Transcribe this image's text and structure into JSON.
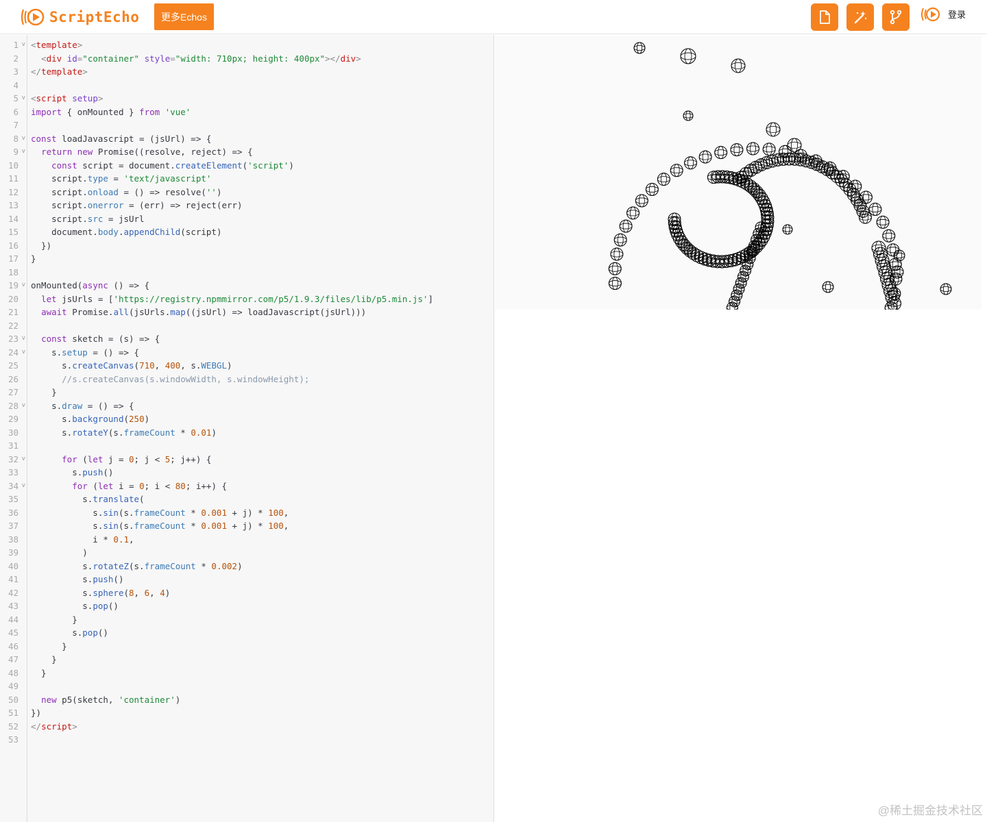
{
  "header": {
    "brand": "ScriptEcho",
    "more_label": "更多Echos",
    "buttons": [
      {
        "name": "new-file-button",
        "icon": "file-icon"
      },
      {
        "name": "magic-wand-button",
        "icon": "magic-wand-icon"
      },
      {
        "name": "fork-button",
        "icon": "git-fork-icon"
      }
    ],
    "login_label": "登录"
  },
  "colors": {
    "accent": "#f5821f"
  },
  "editor": {
    "lines": [
      [
        [
          "tk-punct",
          "<"
        ],
        [
          "tk-tag",
          "template"
        ],
        [
          "tk-punct",
          ">"
        ]
      ],
      [
        [
          "tk-plain",
          "  "
        ],
        [
          "tk-punct",
          "<"
        ],
        [
          "tk-tag",
          "div"
        ],
        [
          "tk-plain",
          " "
        ],
        [
          "tk-attr",
          "id"
        ],
        [
          "tk-punct",
          "="
        ],
        [
          "tk-str",
          "\"container\""
        ],
        [
          "tk-plain",
          " "
        ],
        [
          "tk-attr",
          "style"
        ],
        [
          "tk-punct",
          "="
        ],
        [
          "tk-str",
          "\"width: 710px; height: 400px\""
        ],
        [
          "tk-punct",
          "></"
        ],
        [
          "tk-tag",
          "div"
        ],
        [
          "tk-punct",
          ">"
        ]
      ],
      [
        [
          "tk-punct",
          "</"
        ],
        [
          "tk-tag",
          "template"
        ],
        [
          "tk-punct",
          ">"
        ]
      ],
      [],
      [
        [
          "tk-punct",
          "<"
        ],
        [
          "tk-tag",
          "script"
        ],
        [
          "tk-plain",
          " "
        ],
        [
          "tk-attr",
          "setup"
        ],
        [
          "tk-punct",
          ">"
        ]
      ],
      [
        [
          "tk-kw",
          "import"
        ],
        [
          "tk-plain",
          " { onMounted } "
        ],
        [
          "tk-kw",
          "from"
        ],
        [
          "tk-plain",
          " "
        ],
        [
          "tk-str",
          "'vue'"
        ]
      ],
      [],
      [
        [
          "tk-kw",
          "const"
        ],
        [
          "tk-plain",
          " loadJavascript = (jsUrl) => {"
        ]
      ],
      [
        [
          "tk-plain",
          "  "
        ],
        [
          "tk-kw",
          "return"
        ],
        [
          "tk-plain",
          " "
        ],
        [
          "tk-kw",
          "new"
        ],
        [
          "tk-plain",
          " Promise((resolve, reject) => {"
        ]
      ],
      [
        [
          "tk-plain",
          "    "
        ],
        [
          "tk-kw",
          "const"
        ],
        [
          "tk-plain",
          " script = document."
        ],
        [
          "tk-fn",
          "createElement"
        ],
        [
          "tk-plain",
          "("
        ],
        [
          "tk-str",
          "'script'"
        ],
        [
          "tk-plain",
          ")"
        ]
      ],
      [
        [
          "tk-plain",
          "    script."
        ],
        [
          "tk-prop",
          "type"
        ],
        [
          "tk-plain",
          " = "
        ],
        [
          "tk-str",
          "'text/javascript'"
        ]
      ],
      [
        [
          "tk-plain",
          "    script."
        ],
        [
          "tk-prop",
          "onload"
        ],
        [
          "tk-plain",
          " = () => resolve("
        ],
        [
          "tk-str",
          "''"
        ],
        [
          "tk-plain",
          ")"
        ]
      ],
      [
        [
          "tk-plain",
          "    script."
        ],
        [
          "tk-prop",
          "onerror"
        ],
        [
          "tk-plain",
          " = (err) => reject(err)"
        ]
      ],
      [
        [
          "tk-plain",
          "    script."
        ],
        [
          "tk-prop",
          "src"
        ],
        [
          "tk-plain",
          " = jsUrl"
        ]
      ],
      [
        [
          "tk-plain",
          "    document."
        ],
        [
          "tk-prop",
          "body"
        ],
        [
          "tk-plain",
          "."
        ],
        [
          "tk-fn",
          "appendChild"
        ],
        [
          "tk-plain",
          "(script)"
        ]
      ],
      [
        [
          "tk-plain",
          "  })"
        ]
      ],
      [
        [
          "tk-plain",
          "}"
        ]
      ],
      [],
      [
        [
          "tk-plain",
          "onMounted("
        ],
        [
          "tk-kw",
          "async"
        ],
        [
          "tk-plain",
          " () => {"
        ]
      ],
      [
        [
          "tk-plain",
          "  "
        ],
        [
          "tk-kw",
          "let"
        ],
        [
          "tk-plain",
          " jsUrls = ["
        ],
        [
          "tk-str",
          "'https://registry.npmmirror.com/p5/1.9.3/files/lib/p5.min.js'"
        ],
        [
          "tk-plain",
          "]"
        ]
      ],
      [
        [
          "tk-plain",
          "  "
        ],
        [
          "tk-kw",
          "await"
        ],
        [
          "tk-plain",
          " Promise."
        ],
        [
          "tk-fn",
          "all"
        ],
        [
          "tk-plain",
          "(jsUrls."
        ],
        [
          "tk-fn",
          "map"
        ],
        [
          "tk-plain",
          "((jsUrl) => loadJavascript(jsUrl)))"
        ]
      ],
      [],
      [
        [
          "tk-plain",
          "  "
        ],
        [
          "tk-kw",
          "const"
        ],
        [
          "tk-plain",
          " sketch = (s) => {"
        ]
      ],
      [
        [
          "tk-plain",
          "    s."
        ],
        [
          "tk-prop",
          "setup"
        ],
        [
          "tk-plain",
          " = () => {"
        ]
      ],
      [
        [
          "tk-plain",
          "      s."
        ],
        [
          "tk-fn",
          "createCanvas"
        ],
        [
          "tk-plain",
          "("
        ],
        [
          "tk-num",
          "710"
        ],
        [
          "tk-plain",
          ", "
        ],
        [
          "tk-num",
          "400"
        ],
        [
          "tk-plain",
          ", s."
        ],
        [
          "tk-prop",
          "WEBGL"
        ],
        [
          "tk-plain",
          ")"
        ]
      ],
      [
        [
          "tk-plain",
          "      "
        ],
        [
          "tk-cmt",
          "//s.createCanvas(s.windowWidth, s.windowHeight);"
        ]
      ],
      [
        [
          "tk-plain",
          "    }"
        ]
      ],
      [
        [
          "tk-plain",
          "    s."
        ],
        [
          "tk-prop",
          "draw"
        ],
        [
          "tk-plain",
          " = () => {"
        ]
      ],
      [
        [
          "tk-plain",
          "      s."
        ],
        [
          "tk-fn",
          "background"
        ],
        [
          "tk-plain",
          "("
        ],
        [
          "tk-num",
          "250"
        ],
        [
          "tk-plain",
          ")"
        ]
      ],
      [
        [
          "tk-plain",
          "      s."
        ],
        [
          "tk-fn",
          "rotateY"
        ],
        [
          "tk-plain",
          "(s."
        ],
        [
          "tk-prop",
          "frameCount"
        ],
        [
          "tk-plain",
          " * "
        ],
        [
          "tk-num",
          "0.01"
        ],
        [
          "tk-plain",
          ")"
        ]
      ],
      [],
      [
        [
          "tk-plain",
          "      "
        ],
        [
          "tk-kw",
          "for"
        ],
        [
          "tk-plain",
          " ("
        ],
        [
          "tk-kw",
          "let"
        ],
        [
          "tk-plain",
          " j = "
        ],
        [
          "tk-num",
          "0"
        ],
        [
          "tk-plain",
          "; j < "
        ],
        [
          "tk-num",
          "5"
        ],
        [
          "tk-plain",
          "; j++) {"
        ]
      ],
      [
        [
          "tk-plain",
          "        s."
        ],
        [
          "tk-fn",
          "push"
        ],
        [
          "tk-plain",
          "()"
        ]
      ],
      [
        [
          "tk-plain",
          "        "
        ],
        [
          "tk-kw",
          "for"
        ],
        [
          "tk-plain",
          " ("
        ],
        [
          "tk-kw",
          "let"
        ],
        [
          "tk-plain",
          " i = "
        ],
        [
          "tk-num",
          "0"
        ],
        [
          "tk-plain",
          "; i < "
        ],
        [
          "tk-num",
          "80"
        ],
        [
          "tk-plain",
          "; i++) {"
        ]
      ],
      [
        [
          "tk-plain",
          "          s."
        ],
        [
          "tk-fn",
          "translate"
        ],
        [
          "tk-plain",
          "("
        ]
      ],
      [
        [
          "tk-plain",
          "            s."
        ],
        [
          "tk-fn",
          "sin"
        ],
        [
          "tk-plain",
          "(s."
        ],
        [
          "tk-prop",
          "frameCount"
        ],
        [
          "tk-plain",
          " * "
        ],
        [
          "tk-num",
          "0.001"
        ],
        [
          "tk-plain",
          " + j) * "
        ],
        [
          "tk-num",
          "100"
        ],
        [
          "tk-plain",
          ","
        ]
      ],
      [
        [
          "tk-plain",
          "            s."
        ],
        [
          "tk-fn",
          "sin"
        ],
        [
          "tk-plain",
          "(s."
        ],
        [
          "tk-prop",
          "frameCount"
        ],
        [
          "tk-plain",
          " * "
        ],
        [
          "tk-num",
          "0.001"
        ],
        [
          "tk-plain",
          " + j) * "
        ],
        [
          "tk-num",
          "100"
        ],
        [
          "tk-plain",
          ","
        ]
      ],
      [
        [
          "tk-plain",
          "            i * "
        ],
        [
          "tk-num",
          "0.1"
        ],
        [
          "tk-plain",
          ","
        ]
      ],
      [
        [
          "tk-plain",
          "          )"
        ]
      ],
      [
        [
          "tk-plain",
          "          s."
        ],
        [
          "tk-fn",
          "rotateZ"
        ],
        [
          "tk-plain",
          "(s."
        ],
        [
          "tk-prop",
          "frameCount"
        ],
        [
          "tk-plain",
          " * "
        ],
        [
          "tk-num",
          "0.002"
        ],
        [
          "tk-plain",
          ")"
        ]
      ],
      [
        [
          "tk-plain",
          "          s."
        ],
        [
          "tk-fn",
          "push"
        ],
        [
          "tk-plain",
          "()"
        ]
      ],
      [
        [
          "tk-plain",
          "          s."
        ],
        [
          "tk-fn",
          "sphere"
        ],
        [
          "tk-plain",
          "("
        ],
        [
          "tk-num",
          "8"
        ],
        [
          "tk-plain",
          ", "
        ],
        [
          "tk-num",
          "6"
        ],
        [
          "tk-plain",
          ", "
        ],
        [
          "tk-num",
          "4"
        ],
        [
          "tk-plain",
          ")"
        ]
      ],
      [
        [
          "tk-plain",
          "          s."
        ],
        [
          "tk-fn",
          "pop"
        ],
        [
          "tk-plain",
          "()"
        ]
      ],
      [
        [
          "tk-plain",
          "        }"
        ]
      ],
      [
        [
          "tk-plain",
          "        s."
        ],
        [
          "tk-fn",
          "pop"
        ],
        [
          "tk-plain",
          "()"
        ]
      ],
      [
        [
          "tk-plain",
          "      }"
        ]
      ],
      [
        [
          "tk-plain",
          "    }"
        ]
      ],
      [
        [
          "tk-plain",
          "  }"
        ]
      ],
      [],
      [
        [
          "tk-plain",
          "  "
        ],
        [
          "tk-kw",
          "new"
        ],
        [
          "tk-plain",
          " p5(sketch, "
        ],
        [
          "tk-str",
          "'container'"
        ],
        [
          "tk-plain",
          ")"
        ]
      ],
      [
        [
          "tk-plain",
          "})"
        ]
      ],
      [
        [
          "tk-punct",
          "</"
        ],
        [
          "tk-tag",
          "script"
        ],
        [
          "tk-punct",
          ">"
        ]
      ],
      []
    ],
    "fold_lines": [
      1,
      5,
      8,
      9,
      19,
      23,
      24,
      28,
      32,
      34
    ]
  },
  "preview": {
    "watermark": "@稀土掘金技术社区"
  }
}
